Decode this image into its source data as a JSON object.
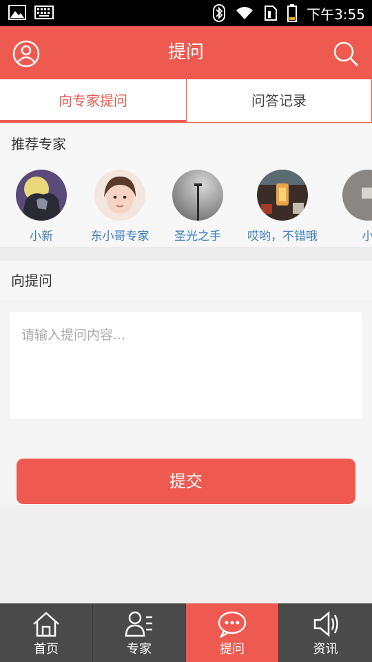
{
  "status_bar": {
    "time": "下午3:55"
  },
  "header": {
    "title": "提问"
  },
  "tabs": [
    {
      "label": "向专家提问",
      "active": true
    },
    {
      "label": "问答记录",
      "active": false
    }
  ],
  "recommend": {
    "title": "推荐专家",
    "experts": [
      {
        "name": "小新"
      },
      {
        "name": "东小哥专家"
      },
      {
        "name": "圣光之手"
      },
      {
        "name": "哎哟，不错哦"
      },
      {
        "name": "小"
      }
    ]
  },
  "question": {
    "title": "向提问",
    "placeholder": "请输入提问内容...",
    "submit_label": "提交"
  },
  "bottom_nav": [
    {
      "label": "首页",
      "icon": "home-icon",
      "active": false
    },
    {
      "label": "专家",
      "icon": "experts-list-icon",
      "active": false
    },
    {
      "label": "提问",
      "icon": "chat-bubble-icon",
      "active": true
    },
    {
      "label": "资讯",
      "icon": "speaker-icon",
      "active": false
    }
  ],
  "colors": {
    "accent": "#ef5a50",
    "link": "#3b7bbf",
    "nav_bg": "#4a4a4a"
  }
}
